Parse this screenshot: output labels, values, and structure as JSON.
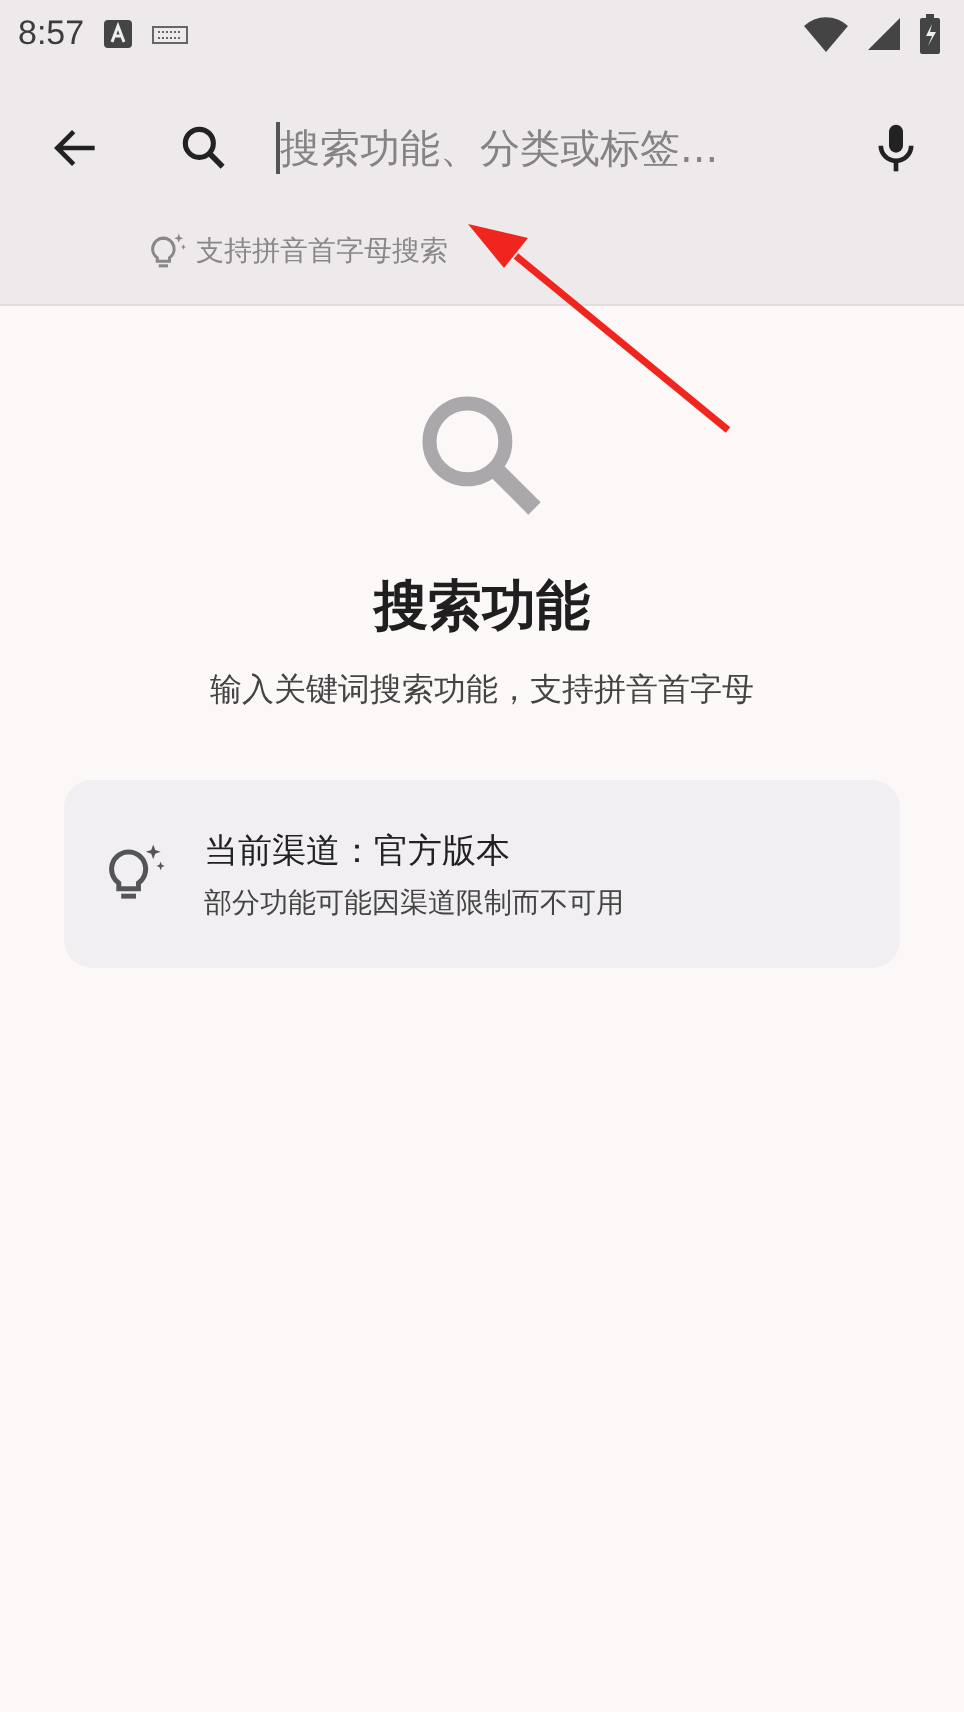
{
  "status_bar": {
    "time": "8:57"
  },
  "search": {
    "placeholder": "搜索功能、分类或标签..."
  },
  "hint": "支持拼音首字母搜索",
  "empty_state": {
    "title": "搜索功能",
    "subtitle": "输入关键词搜索功能，支持拼音首字母"
  },
  "channel_card": {
    "title": "当前渠道：官方版本",
    "subtitle": "部分功能可能因渠道限制而不可用"
  }
}
